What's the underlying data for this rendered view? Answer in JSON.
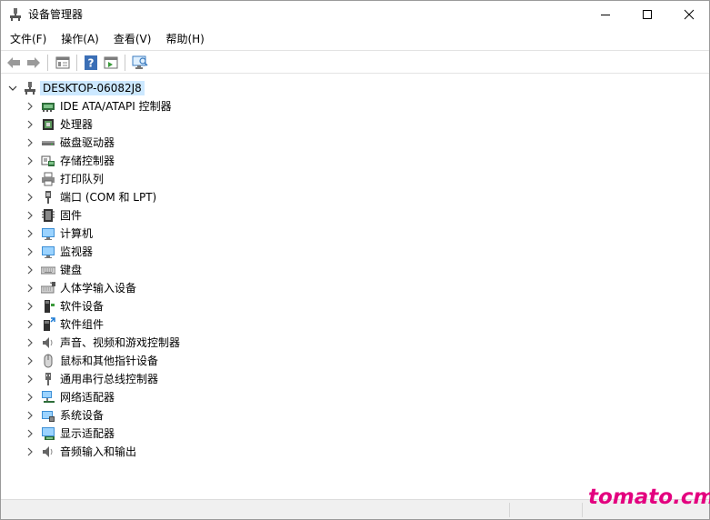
{
  "window": {
    "title": "设备管理器",
    "app_icon": "device-manager-icon",
    "caption_buttons": [
      "minimize-icon",
      "maximize-icon",
      "close-icon"
    ]
  },
  "menubar": {
    "items": [
      {
        "label": "文件(F)"
      },
      {
        "label": "操作(A)"
      },
      {
        "label": "查看(V)"
      },
      {
        "label": "帮助(H)"
      }
    ]
  },
  "toolbar": {
    "buttons": [
      "back-icon",
      "forward-icon",
      "show-hide-console-tree-icon",
      "help-icon",
      "action-pane-icon",
      "monitor-icon"
    ]
  },
  "tree": {
    "root": {
      "label": "DESKTOP-06082J8",
      "expanded": true
    },
    "categories": [
      {
        "label": "IDE ATA/ATAPI 控制器",
        "icon": "ide-controller-icon"
      },
      {
        "label": "处理器",
        "icon": "processor-icon"
      },
      {
        "label": "磁盘驱动器",
        "icon": "disk-drive-icon"
      },
      {
        "label": "存储控制器",
        "icon": "storage-controller-icon"
      },
      {
        "label": "打印队列",
        "icon": "print-queue-icon"
      },
      {
        "label": "端口 (COM 和 LPT)",
        "icon": "port-icon"
      },
      {
        "label": "固件",
        "icon": "firmware-icon"
      },
      {
        "label": "计算机",
        "icon": "computer-icon"
      },
      {
        "label": "监视器",
        "icon": "monitor-icon"
      },
      {
        "label": "键盘",
        "icon": "keyboard-icon"
      },
      {
        "label": "人体学输入设备",
        "icon": "hid-icon"
      },
      {
        "label": "软件设备",
        "icon": "software-device-icon"
      },
      {
        "label": "软件组件",
        "icon": "software-component-icon"
      },
      {
        "label": "声音、视频和游戏控制器",
        "icon": "speaker-icon"
      },
      {
        "label": "鼠标和其他指针设备",
        "icon": "mouse-icon"
      },
      {
        "label": "通用串行总线控制器",
        "icon": "usb-icon"
      },
      {
        "label": "网络适配器",
        "icon": "network-adapter-icon"
      },
      {
        "label": "系统设备",
        "icon": "system-device-icon"
      },
      {
        "label": "显示适配器",
        "icon": "display-adapter-icon"
      },
      {
        "label": "音频输入和输出",
        "icon": "audio-io-icon"
      }
    ]
  },
  "watermark": {
    "text": "tomato.cm"
  },
  "colors": {
    "selection": "#cce8ff",
    "watermark": "#e3007f"
  }
}
